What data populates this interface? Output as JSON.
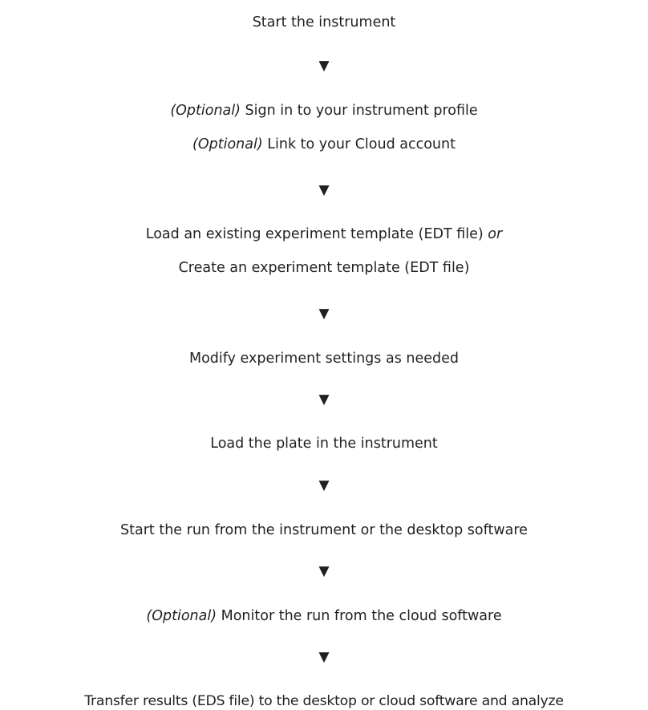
{
  "steps": {
    "s1": "Start the instrument",
    "s2_opt": "(Optional)",
    "s2_text": "Sign in to your instrument profile",
    "s3_opt": "(Optional)",
    "s3_text": "Link to your Cloud account",
    "s4_text": "Load an existing experiment template (EDT file)",
    "s4_or": "or",
    "s5": "Create an experiment template (EDT file)",
    "s6": "Modify experiment settings as needed",
    "s7": "Load the plate in the instrument",
    "s8": "Start the run from the instrument or the desktop software",
    "s9_opt": "(Optional)",
    "s9_text": "Monitor the run from the cloud software",
    "s10": "Transfer results (EDS file) to the desktop or cloud software and analyze"
  },
  "arrow_glyph": "▼"
}
